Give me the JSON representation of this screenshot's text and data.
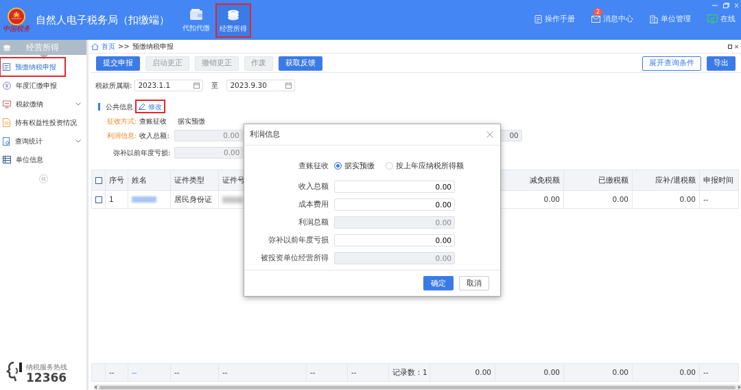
{
  "app": {
    "title": "自然人电子税务局（扣缴端）",
    "logo_text": "中国税务"
  },
  "top_nav": [
    {
      "label": "代扣代缴",
      "selected": false,
      "annotated": false
    },
    {
      "label": "经营所得",
      "selected": true,
      "annotated": true
    }
  ],
  "header_links": [
    {
      "label": "操作手册"
    },
    {
      "label": "消息中心",
      "badge": "2"
    },
    {
      "label": "单位管理"
    },
    {
      "label": "在线"
    }
  ],
  "sidebar": {
    "title": "经营所得",
    "items": [
      {
        "label": "预缴纳税申报",
        "selected": true,
        "annotated": true,
        "expandable": false
      },
      {
        "label": "年度汇缴申报",
        "selected": false,
        "annotated": false,
        "expandable": false
      },
      {
        "label": "税款缴纳",
        "selected": false,
        "annotated": false,
        "expandable": true
      },
      {
        "label": "持有权益性投资情况",
        "selected": false,
        "annotated": false,
        "expandable": false
      },
      {
        "label": "查询统计",
        "selected": false,
        "annotated": false,
        "expandable": true
      },
      {
        "label": "单位信息",
        "selected": false,
        "annotated": false,
        "expandable": false
      }
    ],
    "hotline": {
      "caption": "纳税服务热线",
      "number": "12366"
    }
  },
  "breadcrumb": {
    "separator": ">>",
    "items": [
      {
        "label": "首页",
        "kind": "link"
      },
      {
        "label": "预缴纳税申报",
        "kind": "current"
      }
    ]
  },
  "toolbar": {
    "left": [
      {
        "label": "提交申报",
        "disabled": false
      },
      {
        "label": "启动更正",
        "disabled": true
      },
      {
        "label": "撤销更正",
        "disabled": true
      },
      {
        "label": "作废",
        "disabled": true
      },
      {
        "label": "获取反馈",
        "disabled": false
      }
    ],
    "right": [
      "展开查询条件",
      "导出"
    ]
  },
  "period": {
    "label": "税款所属期:",
    "from": "2023.1.1",
    "to_label": "至",
    "to": "2023.9.30"
  },
  "public_info": {
    "title": "公共信息",
    "edit": {
      "label": "修改",
      "annotated": true
    },
    "collection": {
      "label": "征收方式:",
      "values": [
        "查账征收",
        "据实预缴"
      ]
    },
    "profit": {
      "label": "利润信息:",
      "field_label": "收入总额:",
      "value": "0.00",
      "partial_value": "00"
    },
    "loss": {
      "label": "弥补以前年度亏损:",
      "value": "0.00"
    }
  },
  "table": {
    "header_checked": false,
    "columns": [
      "序号",
      "姓名",
      "证件类型",
      "证件号",
      "减免税额",
      "已缴税额",
      "应补/退税额",
      "申报时间"
    ],
    "rows": [
      {
        "checked": false,
        "cells": [
          {
            "kind": "text",
            "text": "1"
          },
          {
            "kind": "blurred"
          },
          {
            "kind": "text",
            "text": "居民身份证"
          },
          {
            "kind": "blurred"
          },
          {
            "kind": "text",
            "text": "0.00"
          },
          {
            "kind": "text",
            "text": "0.00"
          },
          {
            "kind": "text",
            "text": "0.00"
          },
          {
            "kind": "text",
            "text": "--"
          }
        ]
      }
    ],
    "footer": [
      {
        "kind": "text",
        "text": "--"
      },
      {
        "kind": "link",
        "text": "--"
      },
      {
        "kind": "text",
        "text": "--"
      },
      {
        "kind": "text",
        "text": "--"
      },
      {
        "kind": "text",
        "text": "--"
      },
      {
        "kind": "text",
        "text": "--"
      },
      {
        "kind": "text",
        "text": "记录数：1"
      },
      {
        "kind": "number",
        "text": "0.00"
      },
      {
        "kind": "number",
        "text": "0.00"
      },
      {
        "kind": "number",
        "text": "0.00"
      },
      {
        "kind": "number",
        "text": "0.00"
      },
      {
        "kind": "text",
        "text": "--"
      }
    ]
  },
  "modal": {
    "title": "利润信息",
    "method": {
      "label": "查账征收",
      "options": [
        {
          "label": "据实预缴",
          "selected": true
        },
        {
          "label": "按上年应纳税所得额",
          "selected": false
        }
      ]
    },
    "fields": [
      {
        "label": "收入总额",
        "value": "0.00",
        "disabled": false
      },
      {
        "label": "成本费用",
        "value": "0.00",
        "disabled": false
      },
      {
        "label": "利润总额",
        "value": "0.00",
        "disabled": true
      },
      {
        "label": "弥补以前年度亏损",
        "value": "0.00",
        "disabled": false
      },
      {
        "label": "被投资单位经营所得",
        "value": "0.00",
        "disabled": true
      }
    ],
    "buttons": [
      "确定",
      "取消"
    ]
  }
}
